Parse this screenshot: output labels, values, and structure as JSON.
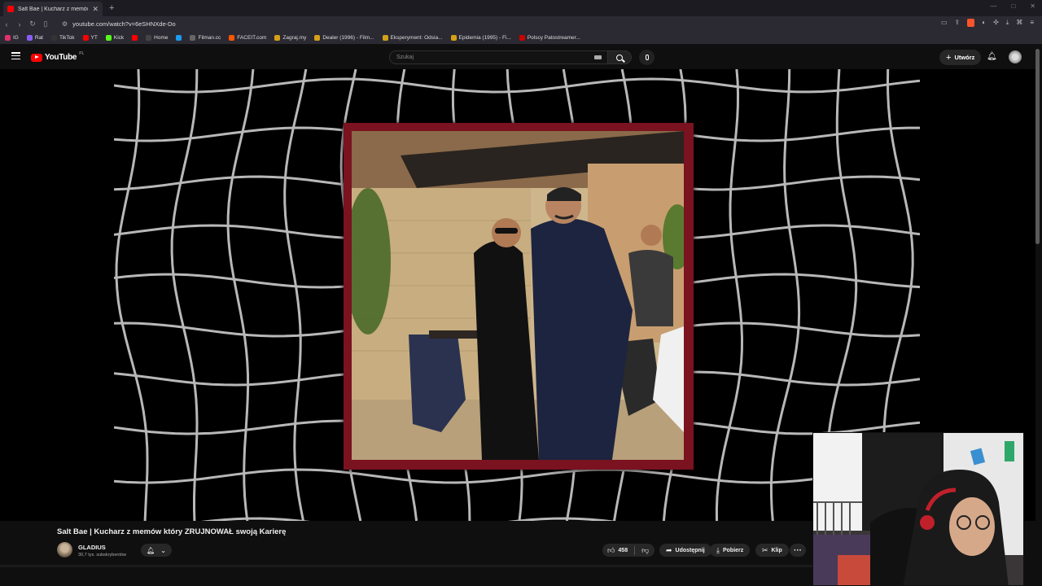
{
  "browser": {
    "tab_title": "Salt Bae | Kucharz z memów któr",
    "url": "youtube.com/watch?v=6eSHNXde-Do",
    "bookmarks": [
      {
        "label": "IG",
        "color": "#e1306c"
      },
      {
        "label": "Rat",
        "color": "#8a5cf6"
      },
      {
        "label": "TikTok",
        "color": "#333333"
      },
      {
        "label": "YT",
        "color": "#ff0000"
      },
      {
        "label": "Kick",
        "color": "#53fc18"
      },
      {
        "label": "",
        "color": "#ff0000"
      },
      {
        "label": "Home",
        "color": "#444444"
      },
      {
        "label": "",
        "color": "#1d9bf0"
      },
      {
        "label": "Filman.cc",
        "color": "#666666"
      },
      {
        "label": "FACEIT.com",
        "color": "#ff5500"
      },
      {
        "label": "Zagraj.my",
        "color": "#d4a017"
      },
      {
        "label": "Dealer (1996) - Film...",
        "color": "#d4a017"
      },
      {
        "label": "Eksperyment: Odsia...",
        "color": "#d4a017"
      },
      {
        "label": "Epidemia (1995) - Fi...",
        "color": "#d4a017"
      },
      {
        "label": "Polscy Patostreamer...",
        "color": "#cc0000"
      }
    ]
  },
  "youtube": {
    "logo_text": "YouTube",
    "country_code": "PL",
    "search_placeholder": "Szukaj",
    "create_label": "Utwórz"
  },
  "video": {
    "title": "Salt Bae | Kucharz z memów który ZRUJNOWAŁ swoją Karierę",
    "channel_name": "GLADIUS",
    "subscribers": "30,7 tys. subskrybentów",
    "likes": "458",
    "share_label": "Udostępnij",
    "download_label": "Pobierz",
    "clip_label": "Klip",
    "more_label": "···"
  },
  "colors": {
    "brand": "#ff0000",
    "frame": "#7a1220",
    "background": "#0f0f0f"
  }
}
